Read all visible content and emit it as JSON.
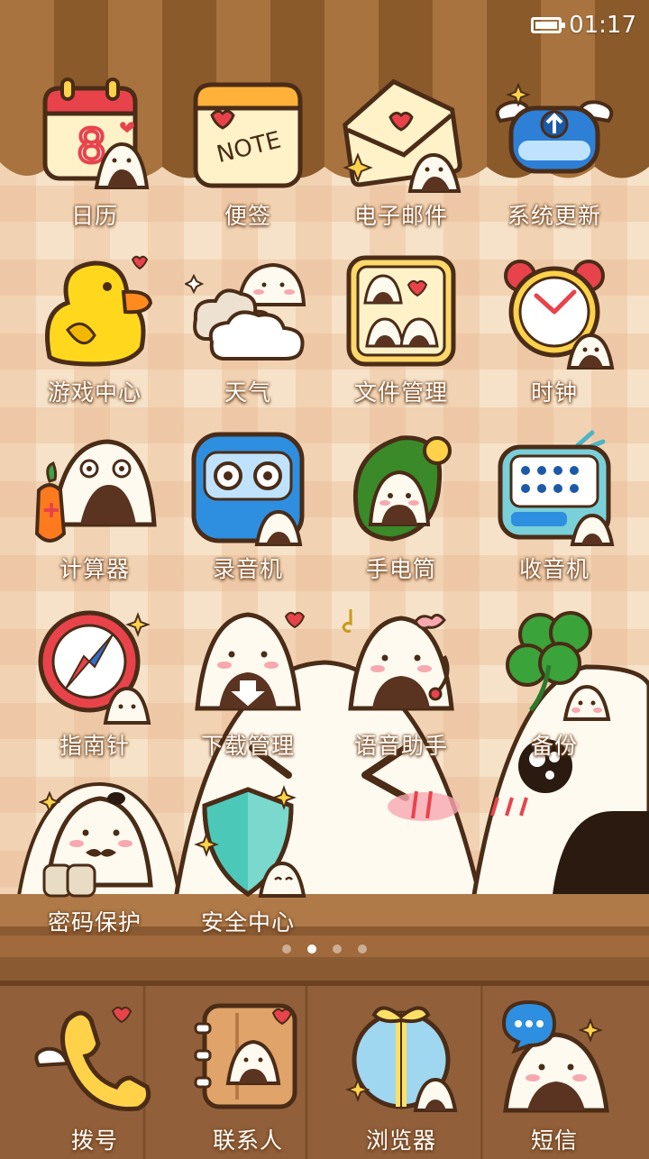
{
  "status_bar": {
    "time": "01:17",
    "battery_icon": "battery-icon"
  },
  "apps": [
    {
      "label": "日历",
      "icon": "calendar-icon"
    },
    {
      "label": "便签",
      "icon": "note-icon"
    },
    {
      "label": "电子邮件",
      "icon": "email-icon"
    },
    {
      "label": "系统更新",
      "icon": "system-update-icon"
    },
    {
      "label": "游戏中心",
      "icon": "duck-icon"
    },
    {
      "label": "天气",
      "icon": "weather-icon"
    },
    {
      "label": "文件管理",
      "icon": "folder-icon"
    },
    {
      "label": "时钟",
      "icon": "alarm-clock-icon"
    },
    {
      "label": "计算器",
      "icon": "calculator-icon"
    },
    {
      "label": "录音机",
      "icon": "recorder-icon"
    },
    {
      "label": "手电筒",
      "icon": "flashlight-icon"
    },
    {
      "label": "收音机",
      "icon": "radio-icon"
    },
    {
      "label": "指南针",
      "icon": "compass-icon"
    },
    {
      "label": "下载管理",
      "icon": "download-icon"
    },
    {
      "label": "语音助手",
      "icon": "voice-assistant-icon"
    },
    {
      "label": "备份",
      "icon": "clover-icon"
    },
    {
      "label": "密码保护",
      "icon": "password-icon"
    },
    {
      "label": "安全中心",
      "icon": "shield-icon"
    }
  ],
  "page_indicator": {
    "count": 4,
    "active": 2
  },
  "dock": [
    {
      "label": "拨号",
      "icon": "phone-icon"
    },
    {
      "label": "联系人",
      "icon": "contacts-icon"
    },
    {
      "label": "浏览器",
      "icon": "browser-icon"
    },
    {
      "label": "短信",
      "icon": "sms-icon"
    }
  ],
  "colors": {
    "awning_dark": "#8b5a2b",
    "awning_light": "#a8733e",
    "wallpaper": "#f6e2c8",
    "outline": "#4a2c17",
    "rice": "#fffaf0",
    "seaweed": "#5a3420",
    "cheek": "#f7a8b0",
    "heart": "#e8434b"
  }
}
